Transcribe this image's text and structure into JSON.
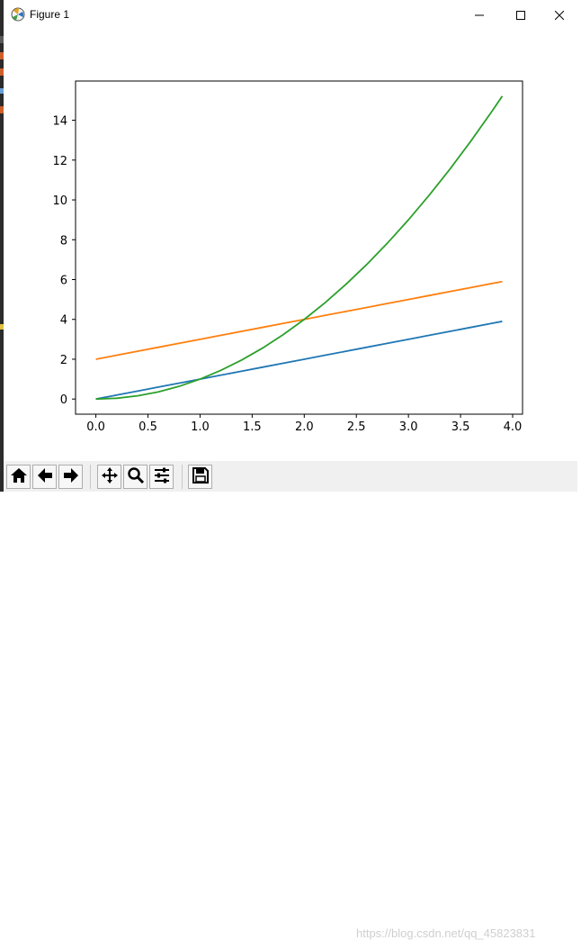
{
  "window": {
    "title": "Figure 1",
    "icons": {
      "app": "matplotlib-icon",
      "minimize": "minimize-icon",
      "maximize": "maximize-icon",
      "close": "close-icon"
    }
  },
  "toolbar": {
    "buttons": [
      {
        "name": "home",
        "icon": "home-icon"
      },
      {
        "name": "back",
        "icon": "arrow-left-icon"
      },
      {
        "name": "forward",
        "icon": "arrow-right-icon"
      },
      {
        "name": "pan",
        "icon": "move-icon"
      },
      {
        "name": "zoom",
        "icon": "magnifier-icon"
      },
      {
        "name": "configure",
        "icon": "sliders-icon"
      },
      {
        "name": "save",
        "icon": "floppy-disk-icon"
      }
    ]
  },
  "watermark": "https://blog.csdn.net/qq_45823831",
  "chart_data": {
    "type": "line",
    "title": "",
    "xlabel": "",
    "ylabel": "",
    "xlim": [
      -0.195,
      4.095
    ],
    "ylim": [
      -0.76,
      15.97
    ],
    "xticks": [
      "0.0",
      "0.5",
      "1.0",
      "1.5",
      "2.0",
      "2.5",
      "3.0",
      "3.5",
      "4.0"
    ],
    "yticks": [
      "0",
      "2",
      "4",
      "6",
      "8",
      "10",
      "12",
      "14"
    ],
    "grid": false,
    "x": [
      0.0,
      0.2,
      0.4,
      0.6,
      0.8,
      1.0,
      1.2,
      1.4,
      1.6,
      1.8,
      2.0,
      2.2,
      2.4,
      2.6,
      2.8,
      3.0,
      3.2,
      3.4,
      3.6,
      3.8,
      3.9
    ],
    "series": [
      {
        "color": "#1f77b4",
        "values": [
          0.0,
          0.2,
          0.4,
          0.6,
          0.8,
          1.0,
          1.2,
          1.4,
          1.6,
          1.8,
          2.0,
          2.2,
          2.4,
          2.6,
          2.8,
          3.0,
          3.2,
          3.4,
          3.6,
          3.8,
          3.9
        ]
      },
      {
        "color": "#ff7f0e",
        "values": [
          2.0,
          2.2,
          2.4,
          2.6,
          2.8,
          3.0,
          3.2,
          3.4,
          3.6,
          3.8,
          4.0,
          4.2,
          4.4,
          4.6,
          4.8,
          5.0,
          5.2,
          5.4,
          5.6,
          5.8,
          5.9
        ]
      },
      {
        "color": "#2ca02c",
        "values": [
          0.0,
          0.04,
          0.16,
          0.36,
          0.64,
          1.0,
          1.44,
          1.96,
          2.56,
          3.24,
          4.0,
          4.84,
          5.76,
          6.76,
          7.84,
          9.0,
          10.24,
          11.56,
          12.96,
          14.44,
          15.21
        ]
      }
    ]
  }
}
